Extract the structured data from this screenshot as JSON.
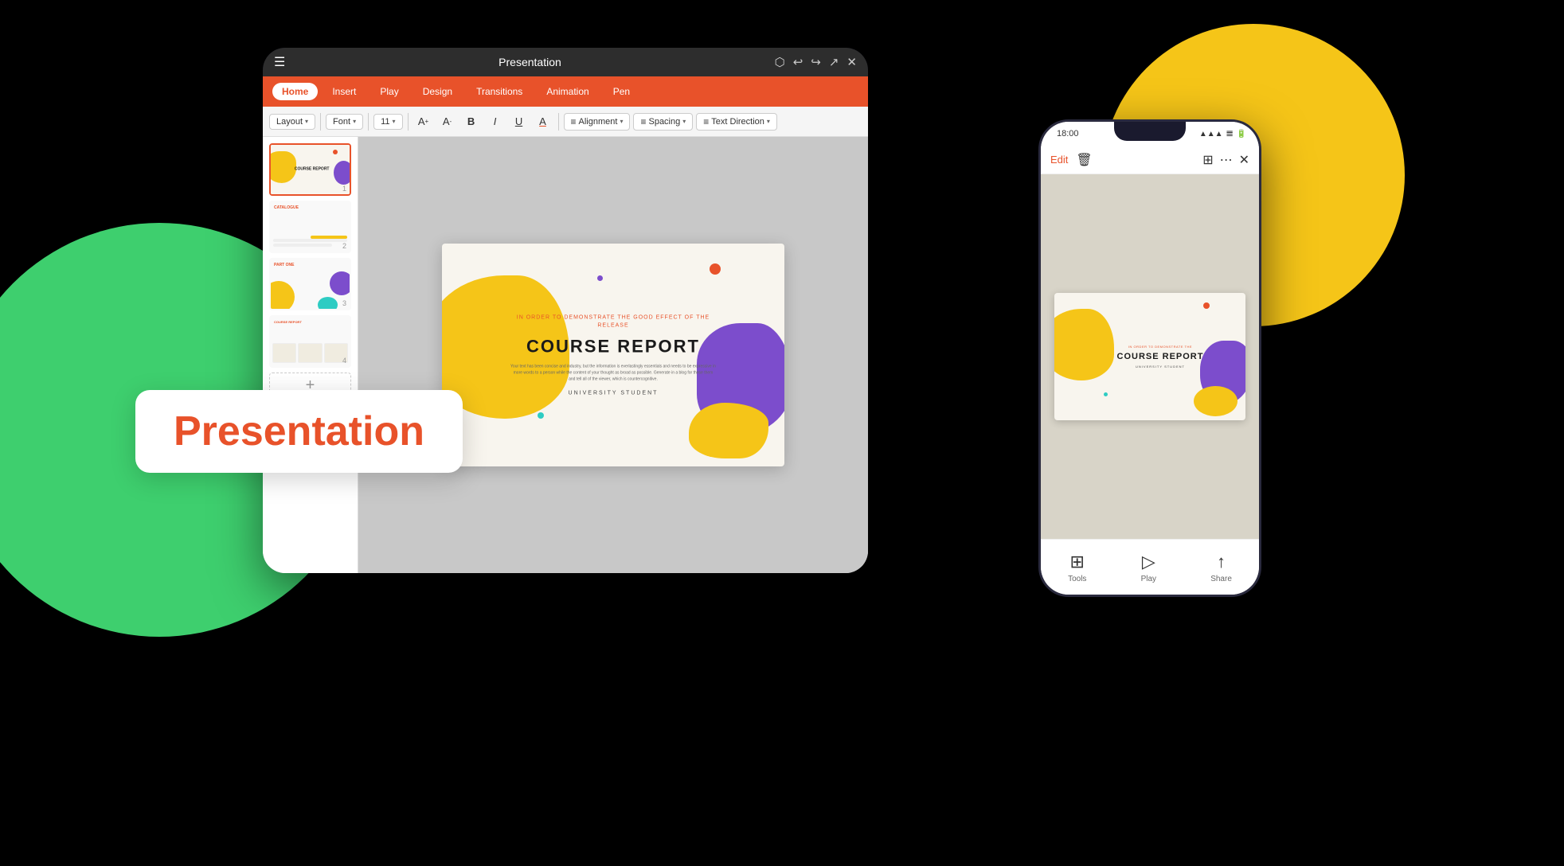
{
  "background": {
    "color": "#000000"
  },
  "circles": {
    "green": {
      "color": "#3ecf6e"
    },
    "yellow": {
      "color": "#f5c518"
    }
  },
  "presentation_label": {
    "text": "Presentation"
  },
  "tablet": {
    "title_bar": {
      "menu_icon": "☰",
      "title": "Presentation",
      "icons": [
        "⬡",
        "↩",
        "↪",
        "↗",
        "✕"
      ]
    },
    "ribbon_tabs": [
      {
        "label": "Home",
        "active": true
      },
      {
        "label": "Insert",
        "active": false
      },
      {
        "label": "Play",
        "active": false
      },
      {
        "label": "Design",
        "active": false
      },
      {
        "label": "Transitions",
        "active": false
      },
      {
        "label": "Animation",
        "active": false
      },
      {
        "label": "Pen",
        "active": false
      }
    ],
    "toolbar": {
      "layout_label": "Layout",
      "font_label": "Font",
      "font_size": "11",
      "bold": "B",
      "italic": "I",
      "underline": "U",
      "font_color": "A",
      "alignment_label": "Alignment",
      "spacing_label": "Spacing",
      "text_direction_label": "Text Direction"
    },
    "slides": [
      {
        "id": 1,
        "active": true,
        "label": "COURSE REPORT"
      },
      {
        "id": 2,
        "active": false,
        "label": "CATALOGUE"
      },
      {
        "id": 3,
        "active": false,
        "label": "PART ONE"
      },
      {
        "id": 4,
        "active": false,
        "label": "COURSE REPORT"
      }
    ],
    "add_slide_label": "+",
    "main_slide": {
      "subtitle_top": "IN ORDER TO DEMONSTRATE THE\nGOOD EFFECT OF THE RELEASE",
      "title": "COURSE REPORT",
      "body": "Your text has been concise and industry, but the information is everlastingly essentials and needs to be expressive in more words to a person while the content of your thought as broad as possible. Generate in a blog for these them and tell all of the viewer, which is countercognitive.",
      "author": "UNIVERSITY STUDENT"
    }
  },
  "phone": {
    "status_bar": {
      "time": "18:00",
      "icons": [
        "📶",
        "🔋"
      ]
    },
    "toolbar": {
      "edit_label": "Edit",
      "icons": [
        "🗑",
        "⊞",
        "⋯",
        "✕"
      ]
    },
    "slide": {
      "subtitle": "IN ORDER TO DEMONSTRATE THE",
      "title": "COURSE REPORT",
      "author": "UNIVERSITY STUDENT"
    },
    "bottom_bar": [
      {
        "icon": "⊞",
        "label": "Tools"
      },
      {
        "icon": "▷",
        "label": "Play"
      },
      {
        "icon": "↗",
        "label": "Share"
      }
    ]
  }
}
